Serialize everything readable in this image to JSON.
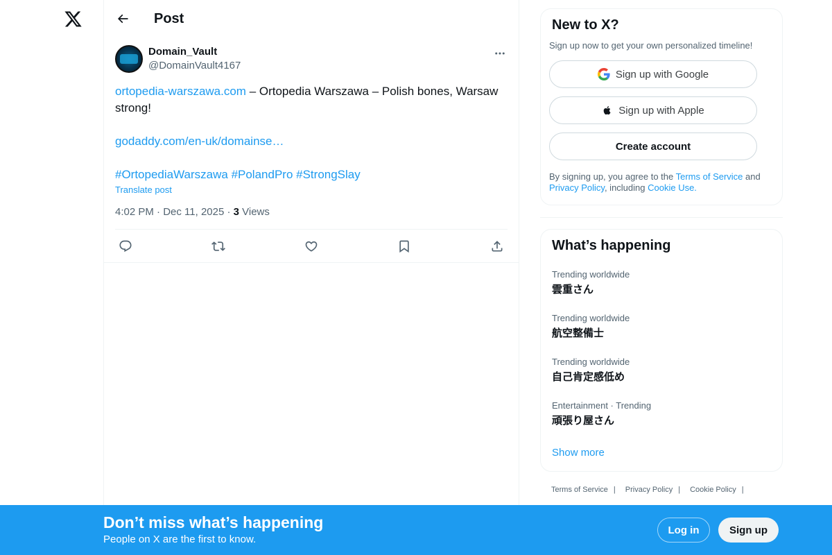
{
  "nav": {
    "logo_icon": "x-logo-icon"
  },
  "header": {
    "title": "Post",
    "back_icon": "back-arrow-icon"
  },
  "post": {
    "author": {
      "display_name": "Domain_Vault",
      "handle": "@DomainVault4167"
    },
    "text_link1": "ortopedia-warszawa.com",
    "text_part1": " – Ortopedia Warszawa – Polish bones, Warsaw strong!",
    "text_link2": "godaddy.com/en-uk/domainse…",
    "hashtags": [
      "#OrtopediaWarszawa",
      "#PolandPro",
      "#StrongSlay"
    ],
    "translate": "Translate post",
    "timestamp": "4:02 PM · Dec 11, 2025 · ",
    "views_count": "3",
    "views_label": " Views",
    "actions": [
      "reply-icon",
      "repost-icon",
      "like-icon",
      "bookmark-icon",
      "share-icon"
    ]
  },
  "signup": {
    "title": "New to X?",
    "subtitle": "Sign up now to get your own personalized timeline!",
    "google": "Sign up with Google",
    "apple": "Sign up with Apple",
    "create": "Create account",
    "legal_1": "By signing up, you agree to the ",
    "terms": "Terms of Service",
    "legal_2": " and ",
    "privacy": "Privacy Policy",
    "legal_3": ", including ",
    "cookie": "Cookie Use."
  },
  "trends": {
    "title": "What’s happening",
    "items": [
      {
        "context": "Trending worldwide",
        "name": "雲重さん"
      },
      {
        "context": "Trending worldwide",
        "name": "航空整備士"
      },
      {
        "context": "Trending worldwide",
        "name": "自己肯定感低め"
      },
      {
        "context": "Entertainment · Trending",
        "name": "頑張り屋さん"
      }
    ],
    "show_more": "Show more"
  },
  "footer": {
    "terms": "Terms of Service",
    "privacy": "Privacy Policy",
    "cookie": "Cookie Policy",
    "sep": "|"
  },
  "bottom_bar": {
    "title": "Don’t miss what’s happening",
    "subtitle": "People on X are the first to know.",
    "login": "Log in",
    "signup": "Sign up"
  },
  "colors": {
    "accent": "#1d9bf0",
    "text": "#0f1419",
    "muted": "#536471"
  }
}
